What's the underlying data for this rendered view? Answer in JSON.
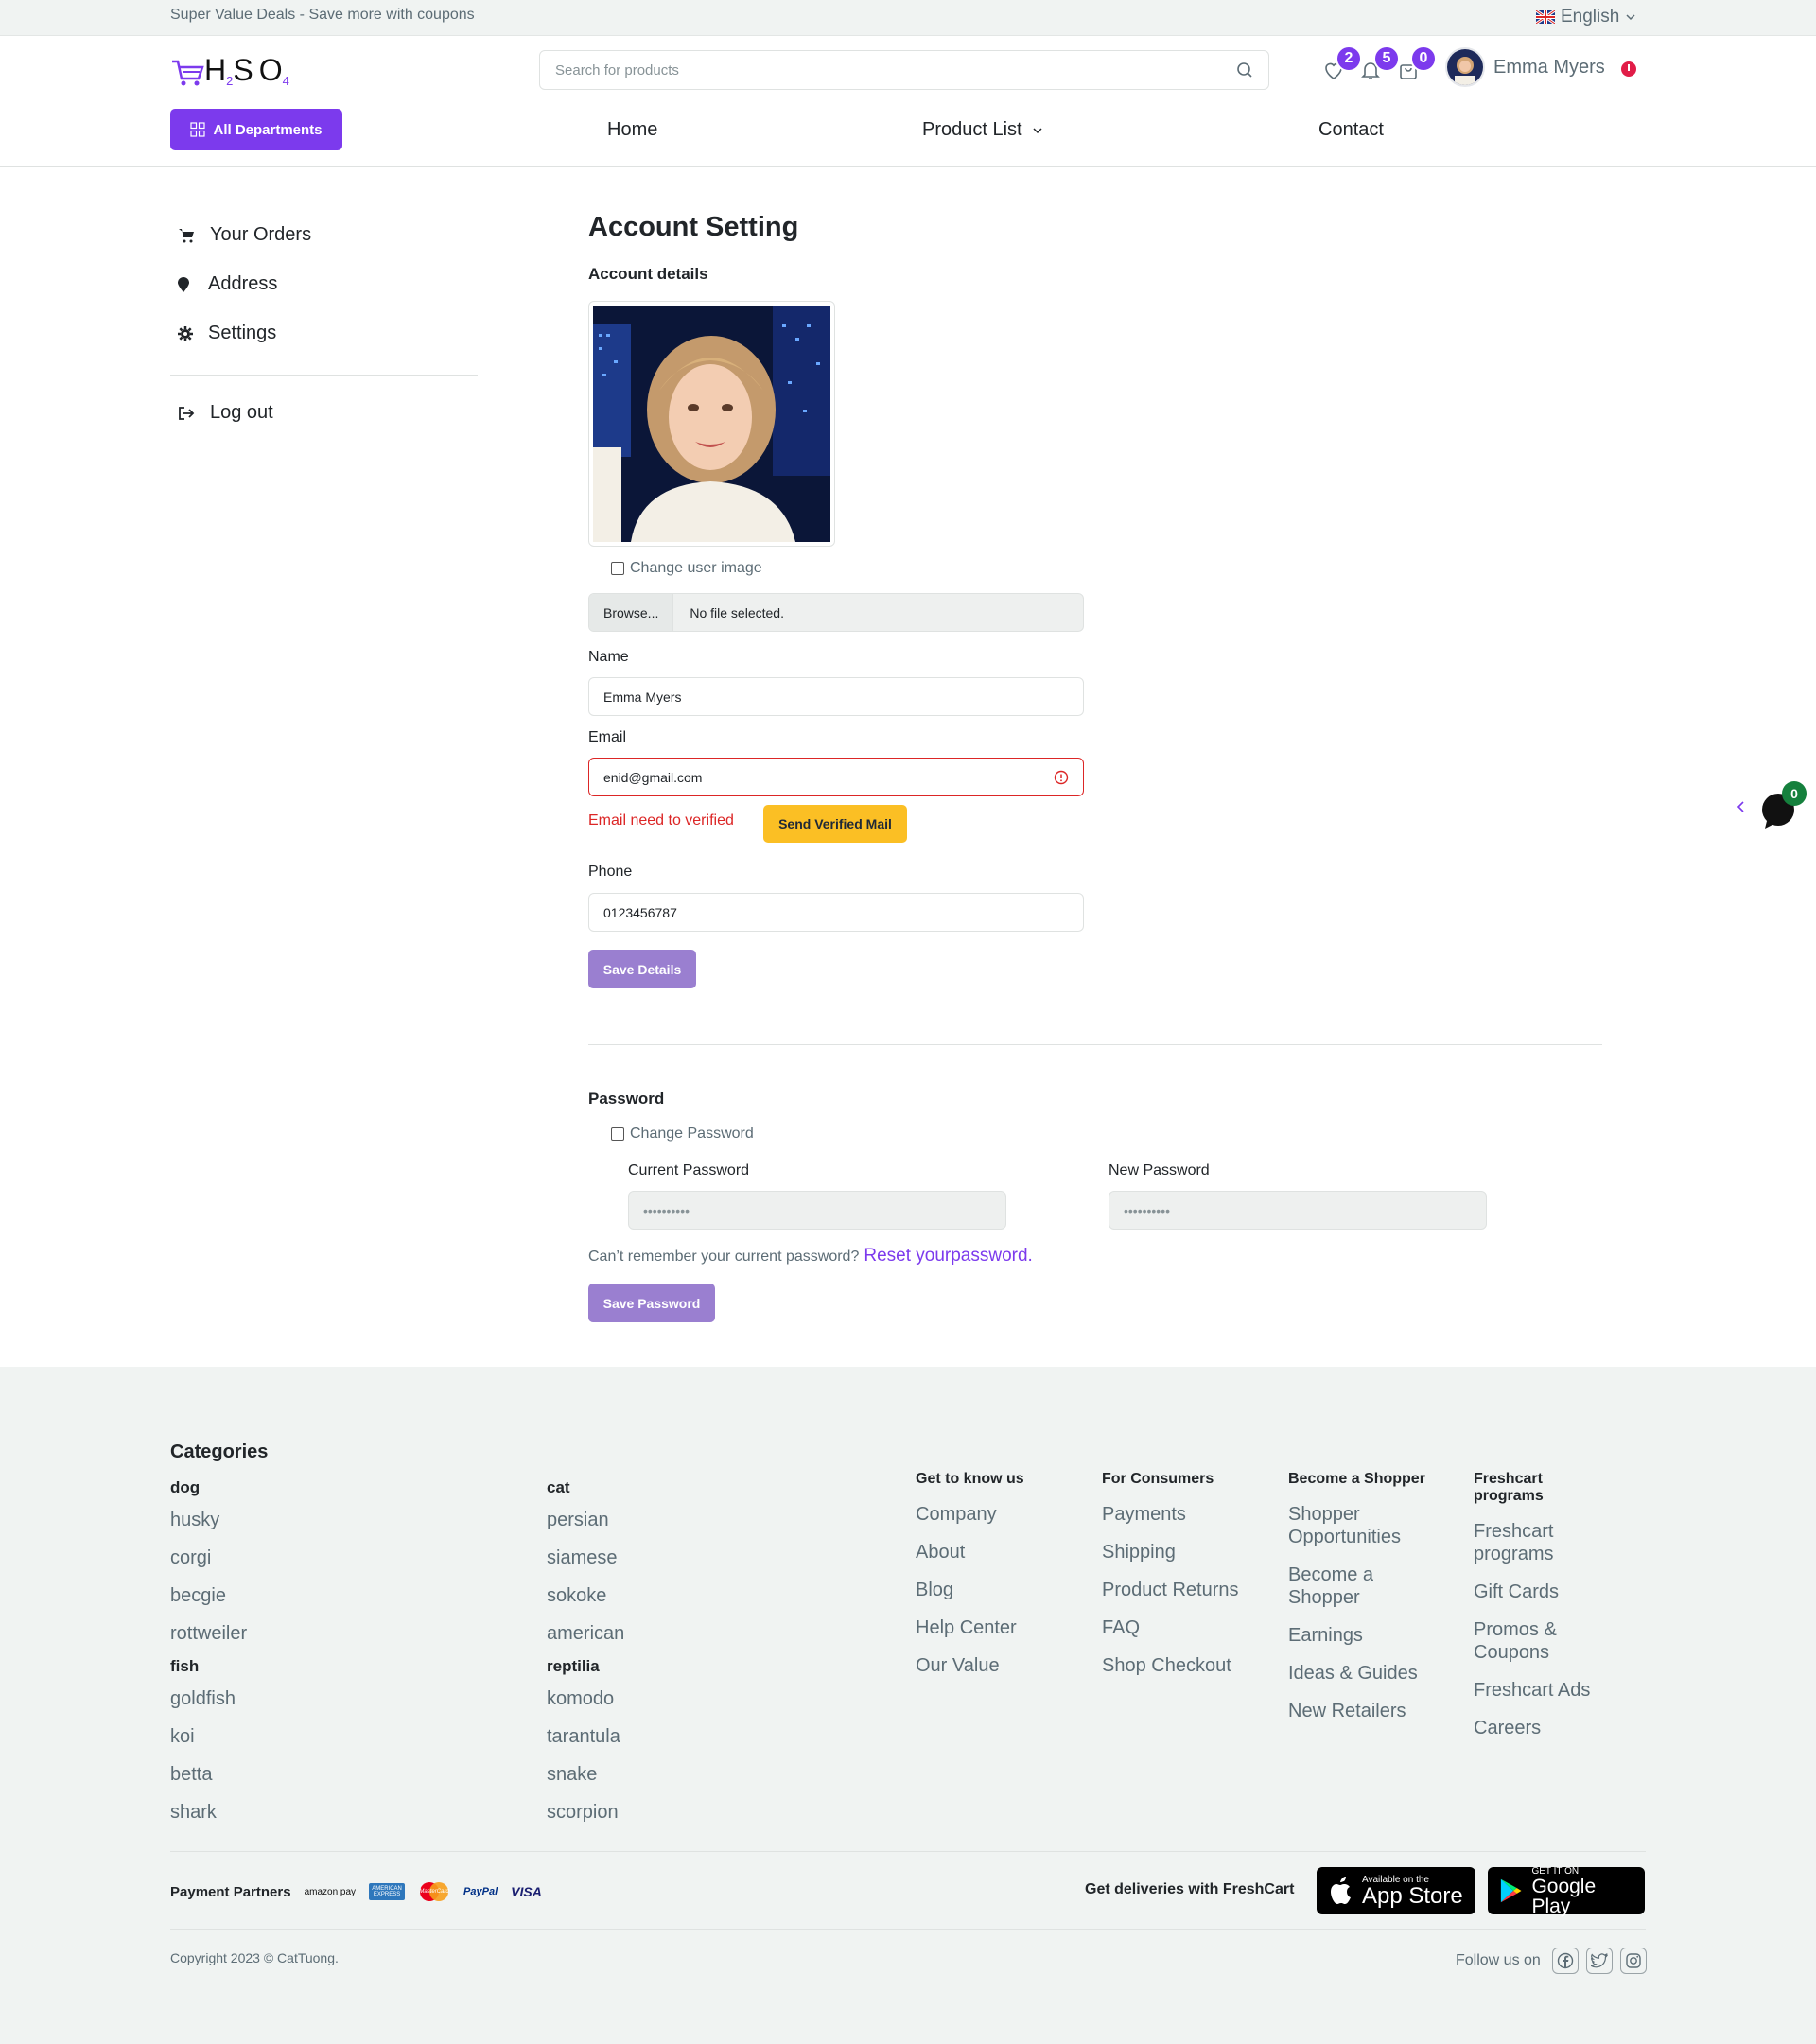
{
  "topbar": {
    "promo": "Super Value Deals - Save more with coupons",
    "language": "English"
  },
  "header": {
    "logo": {
      "h": "H",
      "sub2": "2",
      "s": "S",
      "o": "O",
      "sub4": "4"
    },
    "search_placeholder": "Search for products",
    "wishlist_count": "2",
    "notification_count": "5",
    "cart_count": "0",
    "user_name": "Emma Myers",
    "departments_label": "All Departments",
    "nav": {
      "home": "Home",
      "product_list": "Product List",
      "contact": "Contact"
    }
  },
  "sidebar": {
    "orders": "Your Orders",
    "address": "Address",
    "settings": "Settings",
    "logout": "Log out"
  },
  "account": {
    "title": "Account Setting",
    "details_heading": "Account details",
    "change_image_label": "Change user image",
    "browse_label": "Browse...",
    "file_status": "No file selected.",
    "name_label": "Name",
    "name_value": "Emma Myers",
    "email_label": "Email",
    "email_value": "enid@gmail.com",
    "email_error": "Email need to verified",
    "send_mail_label": "Send Verified Mail",
    "phone_label": "Phone",
    "phone_value": "0123456787",
    "save_details_label": "Save Details"
  },
  "password": {
    "heading": "Password",
    "change_label": "Change Password",
    "current_label": "Current Password",
    "current_value": "••••••••••",
    "new_label": "New Password",
    "new_value": "••••••••••",
    "forgot_text": "Can’t remember your current password?",
    "reset_link": "Reset yourpassword.",
    "save_label": "Save Password"
  },
  "chat": {
    "count": "0"
  },
  "footer": {
    "categories_title": "Categories",
    "cat_groups": [
      {
        "name": "dog",
        "items": [
          "husky",
          "corgi",
          "becgie",
          "rottweiler"
        ]
      },
      {
        "name": "cat",
        "items": [
          "persian",
          "siamese",
          "sokoke",
          "american"
        ]
      },
      {
        "name": "fish",
        "items": [
          "goldfish",
          "koi",
          "betta",
          "shark"
        ]
      },
      {
        "name": "reptilia",
        "items": [
          "komodo",
          "tarantula",
          "snake",
          "scorpion"
        ]
      }
    ],
    "columns": [
      {
        "title": "Get to know us",
        "links": [
          "Company",
          "About",
          "Blog",
          "Help Center",
          "Our Value"
        ]
      },
      {
        "title": "For Consumers",
        "links": [
          "Payments",
          "Shipping",
          "Product Returns",
          "FAQ",
          "Shop Checkout"
        ]
      },
      {
        "title": "Become a Shopper",
        "links": [
          "Shopper Opportunities",
          "Become a Shopper",
          "Earnings",
          "Ideas & Guides",
          "New Retailers"
        ]
      },
      {
        "title": "Freshcart programs",
        "links": [
          "Freshcart programs",
          "Gift Cards",
          "Promos & Coupons",
          "Freshcart Ads",
          "Careers"
        ]
      }
    ],
    "payment_label": "Payment Partners",
    "payments": [
      "amazon pay",
      "AMERICAN EXPRESS",
      "MasterCard",
      "PayPal",
      "VISA"
    ],
    "deliveries_label": "Get deliveries with FreshCart",
    "appstore": {
      "small": "Available on the",
      "big": "App Store"
    },
    "googleplay": {
      "small": "GET IT ON",
      "big": "Google Play"
    },
    "copyright": "Copyright 2023 © CatTuong.",
    "follow_label": "Follow us on"
  },
  "colors": {
    "accent": "#7c3aed",
    "error": "#dc2626",
    "warning": "#fbbf24",
    "footer_bg": "#f0f3f2"
  }
}
